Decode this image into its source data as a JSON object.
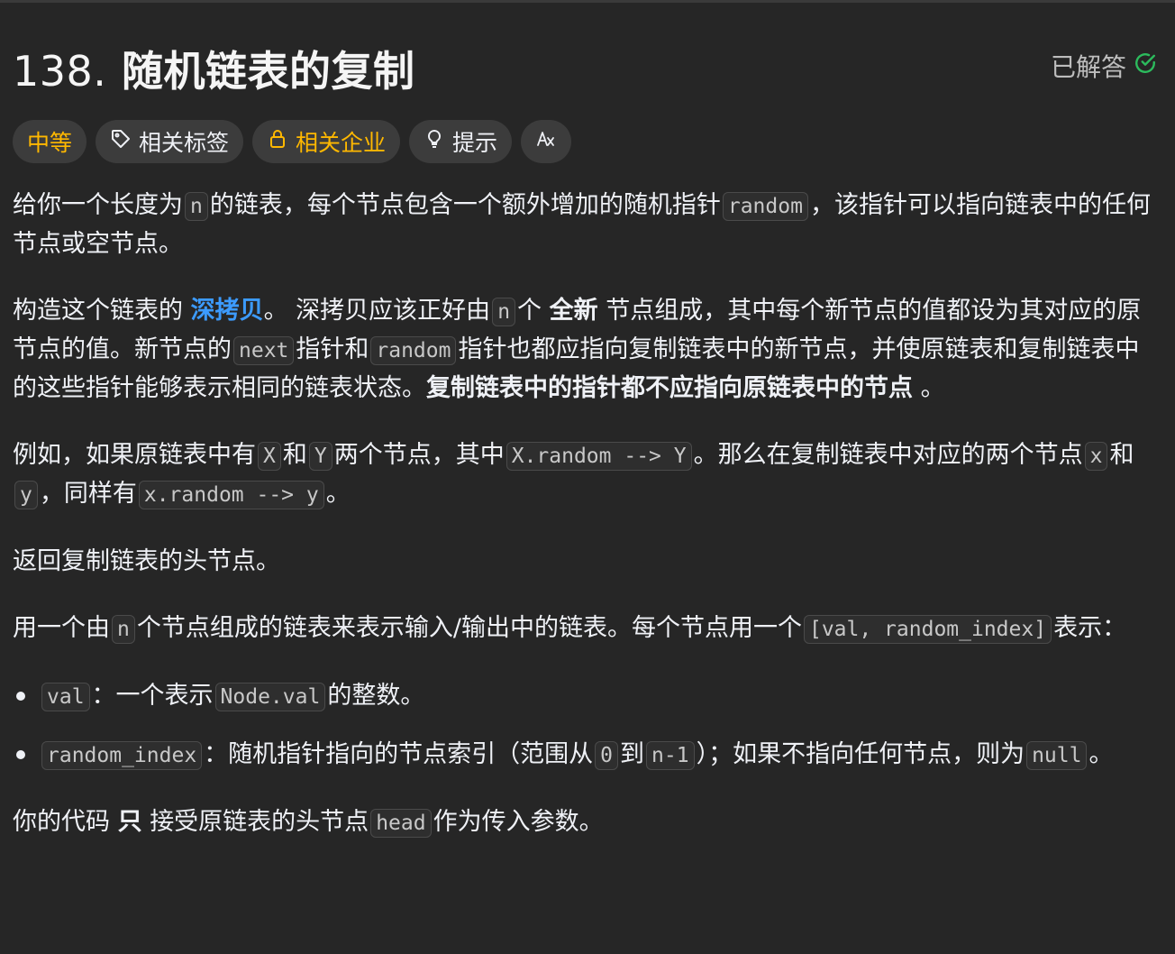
{
  "problem": {
    "number": "138.",
    "title": "随机链表的复制",
    "status": "已解答"
  },
  "tags": {
    "difficulty": "中等",
    "related_tags": "相关标签",
    "related_companies": "相关企业",
    "hint": "提示",
    "translate_icon_text": "Aя"
  },
  "desc": {
    "p1": {
      "a": "给你一个长度为",
      "c1": "n",
      "b": "的链表，每个节点包含一个额外增加的随机指针",
      "c2": "random",
      "c": "，该指针可以指向链表中的任何节点或空节点。"
    },
    "p2": {
      "a": "构造这个链表的",
      "link": "深拷贝",
      "b": "。 深拷贝应该正好由",
      "c1": "n",
      "c": "个",
      "bold1": "全新",
      "d": "节点组成，其中每个新节点的值都设为其对应的原节点的值。新节点的",
      "c2": "next",
      "e": "指针和",
      "c3": "random",
      "f": "指针也都应指向复制链表中的新节点，并使原链表和复制链表中的这些指针能够表示相同的链表状态。",
      "bold2": "复制链表中的指针都不应指向原链表中的节点",
      "g": "。"
    },
    "p3": {
      "a": "例如，如果原链表中有",
      "c1": "X",
      "b": "和",
      "c2": "Y",
      "c": "两个节点，其中",
      "c3": "X.random --> Y",
      "d": "。那么在复制链表中对应的两个节点",
      "c4": "x",
      "e": "和",
      "c5": "y",
      "f": "，同样有",
      "c6": "x.random --> y",
      "g": "。"
    },
    "p4": "返回复制链表的头节点。",
    "p5": {
      "a": "用一个由",
      "c1": "n",
      "b": "个节点组成的链表来表示输入/输出中的链表。每个节点用一个",
      "c2": "[val, random_index]",
      "c": "表示："
    },
    "li1": {
      "c1": "val",
      "a": "：一个表示",
      "c2": "Node.val",
      "b": "的整数。"
    },
    "li2": {
      "c1": "random_index",
      "a": "：随机指针指向的节点索引（范围从",
      "c2": "0",
      "b": "到",
      "c3": "n-1",
      "c": "）；如果不指向任何节点，则为",
      "c4": "null",
      "d": "。"
    },
    "p6": {
      "a": "你的代码",
      "bold": "只",
      "b": "接受原链表的头节点",
      "c1": "head",
      "c": "作为传入参数。"
    }
  },
  "colors": {
    "background": "#262626",
    "accent_yellow": "#ffb800",
    "link_blue": "#3c9bff",
    "solved_green": "#2cbb5d"
  }
}
